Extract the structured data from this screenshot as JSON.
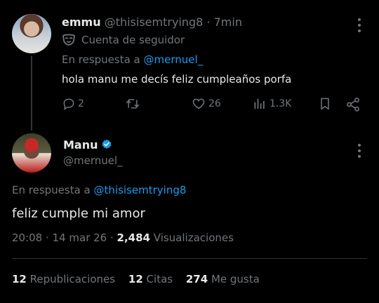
{
  "reply_tweet": {
    "display_name": "emmu",
    "handle": "@thisisemtrying8",
    "separator": "·",
    "time_ago": "7min",
    "follower_badge": "Cuenta de seguidor",
    "in_reply_prefix": "En respuesta a",
    "in_reply_handle": "@mernuel_",
    "text": "hola manu me decís feliz cumpleaños porfa",
    "counts": {
      "replies": "2",
      "retweets": "",
      "likes": "26",
      "views": "1.3K"
    }
  },
  "main_tweet": {
    "display_name": "Manu",
    "handle": "@mernuel_",
    "in_reply_prefix": "En respuesta a",
    "in_reply_handle": "@thisisemtrying8",
    "text": "feliz cumple mi amor",
    "time": "20:08 · 14 mar 26 ·",
    "views_count": "2,484",
    "views_label": "Visualizaciones",
    "stats": [
      {
        "count": "12",
        "label": "Republicaciones"
      },
      {
        "count": "12",
        "label": "Citas"
      },
      {
        "count": "274",
        "label": "Me gusta"
      }
    ]
  },
  "colors": {
    "background": "#000000",
    "text": "#e7e9ea",
    "muted": "#71767b",
    "accent": "#1d9bf0",
    "divider": "#2f3336"
  },
  "icons": [
    "more-icon",
    "mask-icon",
    "reply-icon",
    "retweet-icon",
    "like-icon",
    "views-icon",
    "bookmark-icon",
    "share-icon",
    "verified-icon"
  ]
}
